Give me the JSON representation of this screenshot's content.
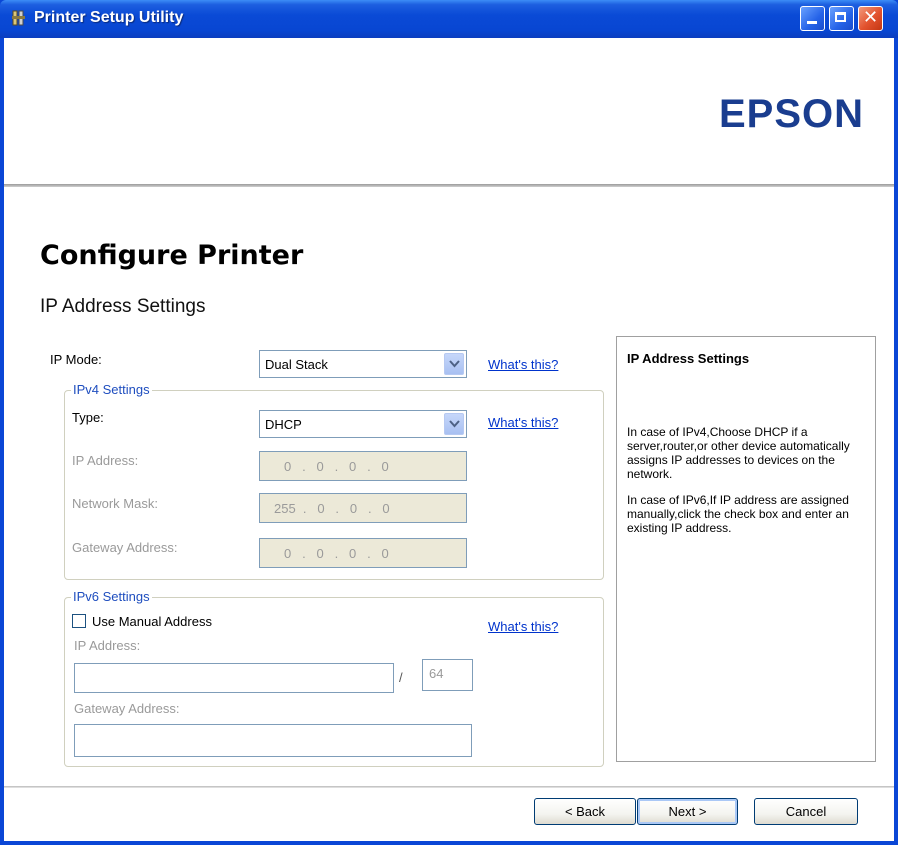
{
  "window": {
    "title": "Printer Setup Utility",
    "minimize_icon": "minimize-icon",
    "maximize_icon": "maximize-icon",
    "close_icon": "close-icon",
    "close_glyph": "✕"
  },
  "header": {
    "logo_text": "EPSON",
    "logo_color": "#1a3d8f"
  },
  "page": {
    "title": "Configure Printer",
    "subtitle": "IP Address Settings"
  },
  "form": {
    "ip_mode_label": "IP Mode:",
    "ip_mode_value": "Dual Stack",
    "whats_this": "What's this?",
    "ipv4": {
      "legend": "IPv4 Settings",
      "type_label": "Type:",
      "type_value": "DHCP",
      "ip_address_label": "IP Address:",
      "ip_address_value": "0   .   0   .   0   .   0",
      "network_mask_label": "Network Mask:",
      "network_mask_value": "255  .   0   .   0   .   0",
      "gateway_label": "Gateway Address:",
      "gateway_value": "0   .   0   .   0   .   0"
    },
    "ipv6": {
      "legend": "IPv6 Settings",
      "use_manual_label": "Use Manual Address",
      "ip_address_label": "IP Address:",
      "ip_address_value": "",
      "separator": "/",
      "prefix_value": "64",
      "gateway_label": "Gateway Address:",
      "gateway_value": ""
    }
  },
  "help": {
    "title": "IP Address Settings",
    "para1": "In case of IPv4,Choose DHCP if a server,router,or other device automatically assigns IP addresses to devices on the network.",
    "para2": "In case of IPv6,If IP address are assigned manually,click the check box and enter an existing IP address."
  },
  "buttons": {
    "back": "< Back",
    "next": "Next >",
    "cancel": "Cancel"
  }
}
